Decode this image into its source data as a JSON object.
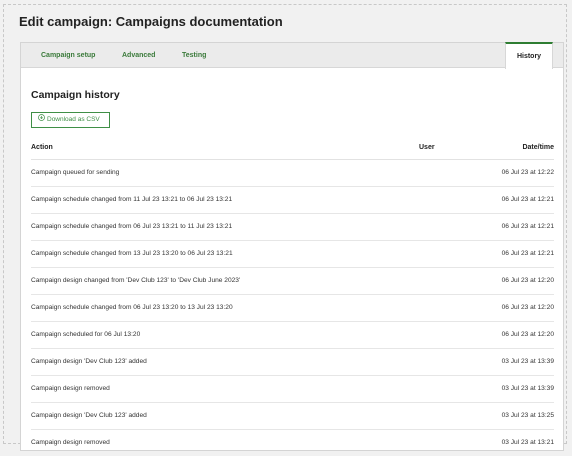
{
  "page": {
    "title": "Edit campaign: Campaigns documentation"
  },
  "tabs": {
    "setup": "Campaign setup",
    "advanced": "Advanced",
    "testing": "Testing",
    "history": "History"
  },
  "history": {
    "title": "Campaign history",
    "download_label": "Download as CSV",
    "columns": {
      "action": "Action",
      "user": "User",
      "date": "Date/time"
    },
    "rows": [
      {
        "action": "Campaign queued for sending",
        "user": "",
        "date": "06 Jul 23 at 12:22"
      },
      {
        "action": "Campaign schedule changed from 11 Jul 23 13:21 to 06 Jul 23 13:21",
        "user": "",
        "date": "06 Jul 23 at 12:21"
      },
      {
        "action": "Campaign schedule changed from 06 Jul 23 13:21 to 11 Jul 23 13:21",
        "user": "",
        "date": "06 Jul 23 at 12:21"
      },
      {
        "action": "Campaign schedule changed from 13 Jul 23 13:20 to 06 Jul 23 13:21",
        "user": "",
        "date": "06 Jul 23 at 12:21"
      },
      {
        "action": "Campaign design changed from 'Dev Club 123' to 'Dev Club June 2023'",
        "user": "",
        "date": "06 Jul 23 at 12:20"
      },
      {
        "action": "Campaign schedule changed from 06 Jul 23 13:20 to 13 Jul 23 13:20",
        "user": "",
        "date": "06 Jul 23 at 12:20"
      },
      {
        "action": "Campaign scheduled for 06 Jul 13:20",
        "user": "",
        "date": "06 Jul 23 at 12:20"
      },
      {
        "action": "Campaign design 'Dev Club 123' added",
        "user": "",
        "date": "03 Jul 23 at 13:39"
      },
      {
        "action": "Campaign design removed",
        "user": "",
        "date": "03 Jul 23 at 13:39"
      },
      {
        "action": "Campaign design 'Dev Club 123' added",
        "user": "",
        "date": "03 Jul 23 at 13:25"
      },
      {
        "action": "Campaign design removed",
        "user": "",
        "date": "03 Jul 23 at 13:21"
      }
    ]
  },
  "colors": {
    "accent": "#2e7d32",
    "tab_text": "#3a7a3a"
  },
  "icons": {
    "download": "download-circle-icon"
  }
}
